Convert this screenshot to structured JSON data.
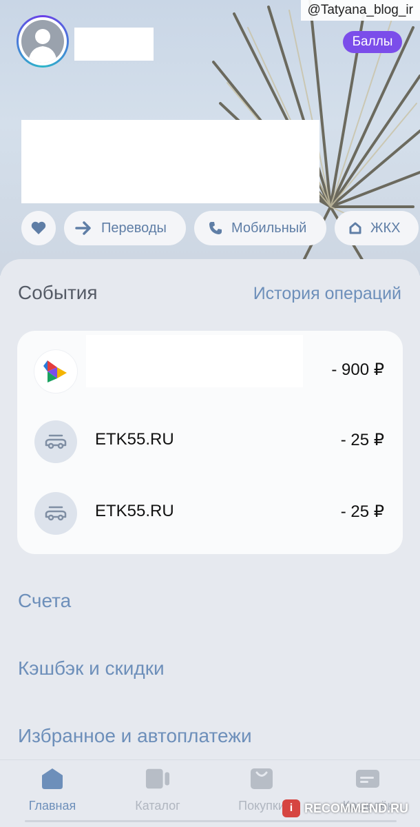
{
  "header": {
    "watermark": "@Tatyana_blog_ir",
    "points_button": "Баллы"
  },
  "quick_actions": {
    "favorites_icon": "heart-icon",
    "transfers": {
      "label": "Переводы",
      "icon": "arrow-right-icon"
    },
    "mobile": {
      "label": "Мобильный",
      "icon": "phone-icon"
    },
    "zhkh": {
      "label": "ЖКХ",
      "icon": "house-icon"
    }
  },
  "events": {
    "title": "События",
    "history_link": "История операций",
    "transactions": [
      {
        "name": "",
        "amount": "- 900 ₽",
        "icon": "colorful-triangles-logo-icon"
      },
      {
        "name": "ETK55.RU",
        "amount": "- 25 ₽",
        "icon": "car-icon"
      },
      {
        "name": "ETK55.RU",
        "amount": "- 25 ₽",
        "icon": "car-icon"
      }
    ]
  },
  "sections": {
    "accounts": "Счета",
    "cashback": "Кэшбэк и скидки",
    "favorites": "Избранное и автоплатежи"
  },
  "nav": {
    "items": [
      {
        "label": "Главная",
        "icon": "home-icon",
        "active": true
      },
      {
        "label": "Каталог",
        "icon": "catalog-icon",
        "active": false
      },
      {
        "label": "Покупки",
        "icon": "shopping-bag-icon",
        "active": false
      },
      {
        "label": "Кошелёк",
        "icon": "card-icon",
        "active": false
      }
    ]
  },
  "watermark_bottom": "RECOMMEND.RU",
  "colors": {
    "accent": "#7b4dea",
    "link": "#6d8fba",
    "background": "#e6e9ef"
  }
}
